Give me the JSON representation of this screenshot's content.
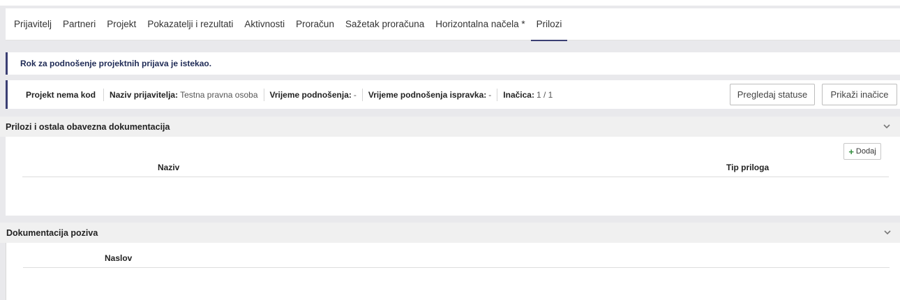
{
  "tabs": [
    {
      "label": "Prijavitelj"
    },
    {
      "label": "Partneri"
    },
    {
      "label": "Projekt"
    },
    {
      "label": "Pokazatelji i rezultati"
    },
    {
      "label": "Aktivnosti"
    },
    {
      "label": "Proračun"
    },
    {
      "label": "Sažetak proračuna"
    },
    {
      "label": "Horizontalna načela *"
    },
    {
      "label": "Prilozi"
    }
  ],
  "active_tab": "Prilozi",
  "notice": "Rok za podnošenje projektnih prijava je istekao.",
  "info": {
    "code": "Projekt nema kod",
    "applicant_label": "Naziv prijavitelja:",
    "applicant_value": "Testna pravna osoba",
    "submit_time_label": "Vrijeme podnošenja:",
    "submit_time_value": "-",
    "correction_time_label": "Vrijeme podnošenja ispravka:",
    "correction_time_value": "-",
    "version_label": "Inačica:",
    "version_value": "1 / 1",
    "statuses_button": "Pregledaj statuse",
    "versions_button": "Prikaži inačice"
  },
  "attachments_panel": {
    "title": "Prilozi i ostala obavezna dokumentacija",
    "add_button": "Dodaj",
    "columns": [
      "Naziv",
      "Tip priloga"
    ]
  },
  "call_docs_panel": {
    "title": "Dokumentacija poziva",
    "columns": [
      "Naslov"
    ]
  },
  "colors": {
    "accent": "#3b3f73",
    "add_icon": "#2e8b3a"
  }
}
